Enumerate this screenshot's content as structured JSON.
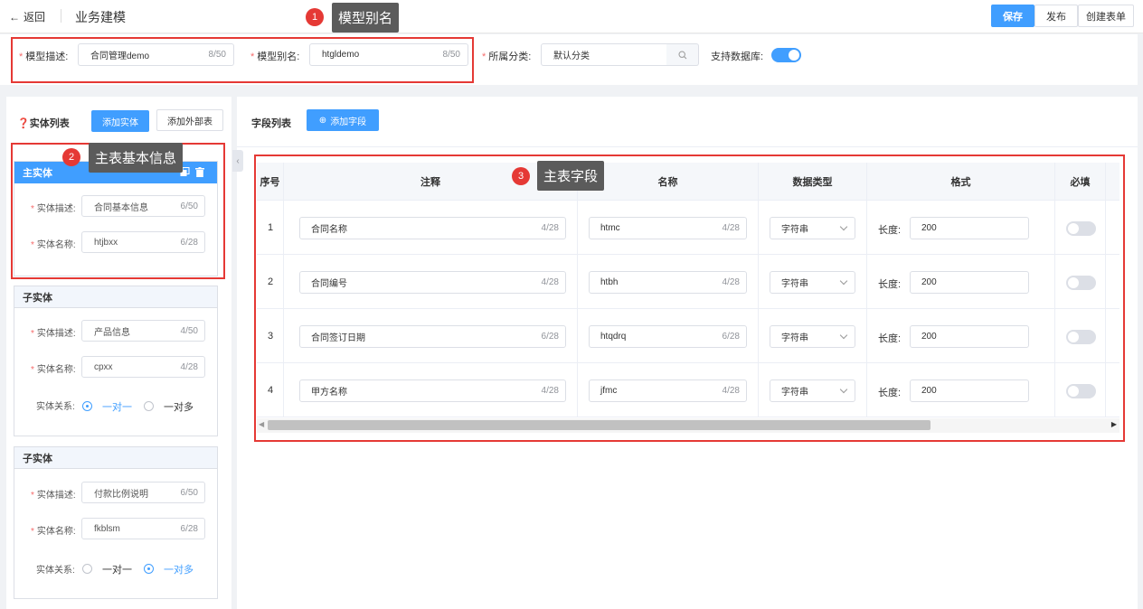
{
  "header": {
    "back_label": "返回",
    "title": "业务建模",
    "save_label": "保存",
    "publish_label": "发布",
    "create_form_label": "创建表单"
  },
  "model_form": {
    "desc_label": "模型描述:",
    "desc_value": "合同管理demo",
    "desc_count": "8/50",
    "alias_label": "模型别名:",
    "alias_value": "htgldemo",
    "alias_count": "8/50",
    "category_label": "所属分类:",
    "category_value": "默认分类",
    "db_label": "支持数据库:",
    "db_enabled": true
  },
  "entity_panel": {
    "title": "❓实体列表",
    "add_entity": "添加实体",
    "add_external": "添加外部表",
    "main_entity": {
      "header": "主实体",
      "desc_label": "实体描述:",
      "desc_value": "合同基本信息",
      "desc_count": "6/50",
      "name_label": "实体名称:",
      "name_value": "htjbxx",
      "name_count": "6/28"
    },
    "sub_entities": [
      {
        "header": "子实体",
        "desc_label": "实体描述:",
        "desc_value": "产品信息",
        "desc_count": "4/50",
        "name_label": "实体名称:",
        "name_value": "cpxx",
        "name_count": "4/28",
        "relation_label": "实体关系:",
        "one_to_one": "一对一",
        "one_to_many": "一对多",
        "relation": "one_to_one"
      },
      {
        "header": "子实体",
        "desc_label": "实体描述:",
        "desc_value": "付款比例说明",
        "desc_count": "6/50",
        "name_label": "实体名称:",
        "name_value": "fkblsm",
        "name_count": "6/28",
        "relation_label": "实体关系:",
        "one_to_one": "一对一",
        "one_to_many": "一对多",
        "relation": "one_to_many"
      }
    ]
  },
  "field_panel": {
    "title": "字段列表",
    "add_field": "添加字段",
    "columns": [
      "序号",
      "注释",
      "名称",
      "数据类型",
      "格式",
      "必填"
    ],
    "rows": [
      {
        "index": "1",
        "comment": "合同名称",
        "comment_count": "4/28",
        "name": "htmc",
        "name_count": "4/28",
        "type": "字符串",
        "format_label": "长度:",
        "length": "200",
        "required": false
      },
      {
        "index": "2",
        "comment": "合同编号",
        "comment_count": "4/28",
        "name": "htbh",
        "name_count": "4/28",
        "type": "字符串",
        "format_label": "长度:",
        "length": "200",
        "required": false
      },
      {
        "index": "3",
        "comment": "合同签订日期",
        "comment_count": "6/28",
        "name": "htqdrq",
        "name_count": "6/28",
        "type": "字符串",
        "format_label": "长度:",
        "length": "200",
        "required": false
      },
      {
        "index": "4",
        "comment": "甲方名称",
        "comment_count": "4/28",
        "name": "jfmc",
        "name_count": "4/28",
        "type": "字符串",
        "format_label": "长度:",
        "length": "200",
        "required": false
      }
    ]
  },
  "annotations": [
    {
      "num": "1",
      "text": "模型别名"
    },
    {
      "num": "2",
      "text": "主表基本信息"
    },
    {
      "num": "3",
      "text": "主表字段"
    }
  ],
  "colors": {
    "accent": "#409eff",
    "annotation": "#e53935"
  }
}
